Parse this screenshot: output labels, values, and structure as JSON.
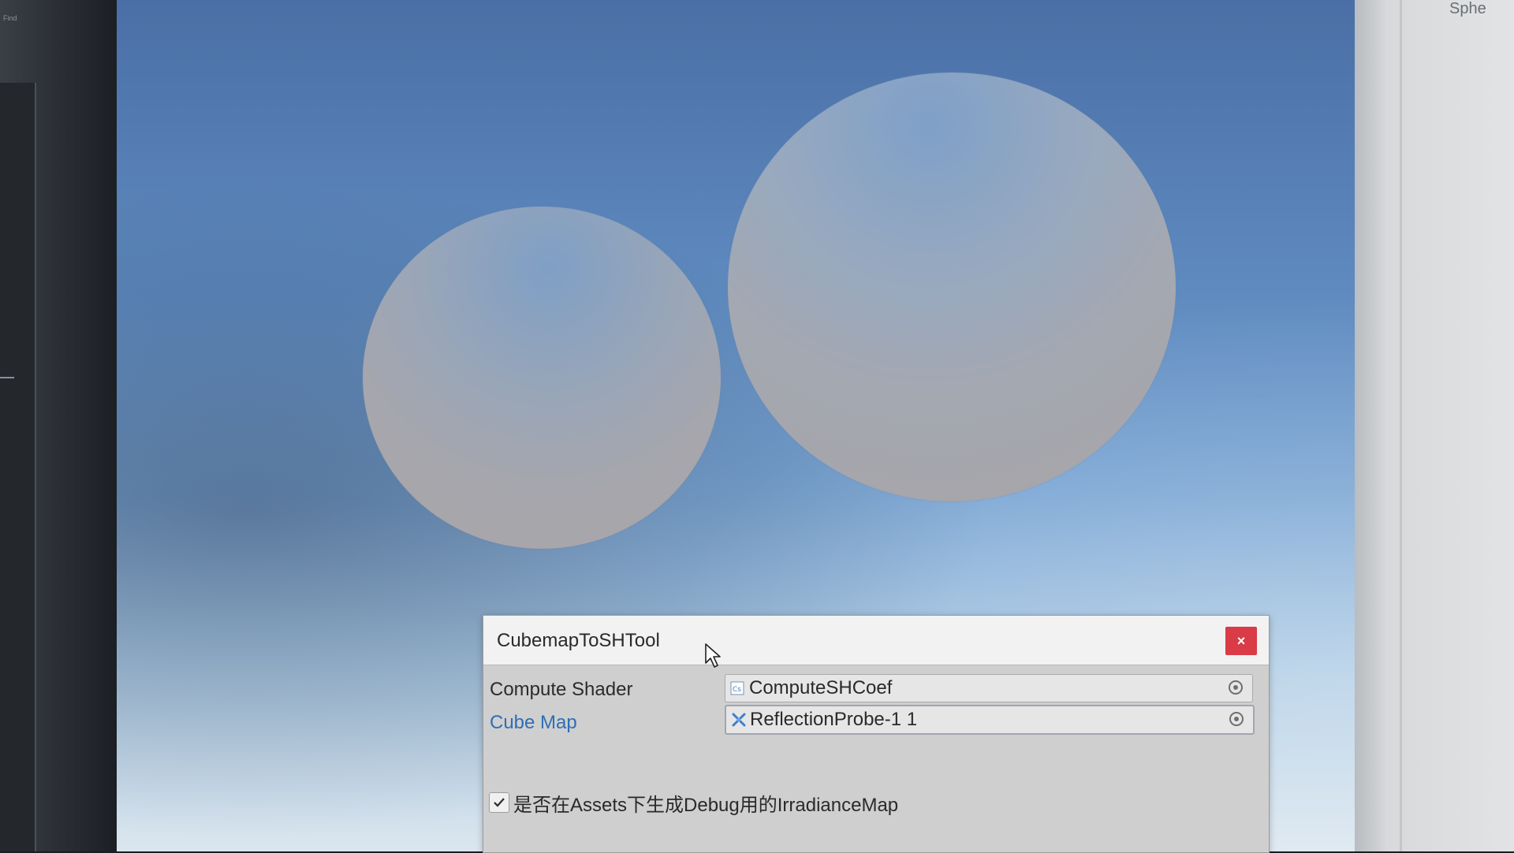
{
  "left_panel": {
    "label": "Find"
  },
  "right_panel": {
    "header": "Sphe"
  },
  "tool_window": {
    "title": "CubemapToSHTool",
    "close_glyph": "×",
    "fields": [
      {
        "label": "Compute Shader",
        "value": "ComputeSHCoef",
        "icon": "compute-shader-icon"
      },
      {
        "label": "Cube Map",
        "value": "ReflectionProbe-1 1",
        "icon": "cubemap-icon"
      }
    ],
    "checkbox": {
      "checked": true,
      "label": "是否在Assets下生成Debug用的IrradianceMap"
    }
  },
  "colors": {
    "close_button": "#d93b47",
    "link_label": "#2d6fb6",
    "sky_top": "#4a6fa6",
    "sky_bottom": "#dbe6ee"
  }
}
